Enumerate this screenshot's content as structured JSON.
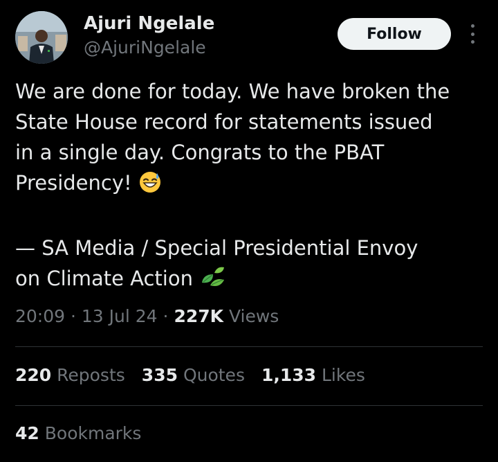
{
  "author": {
    "display_name": "Ajuri Ngelale",
    "handle": "@AjuriNgelale"
  },
  "follow_button_label": "Follow",
  "more_icon": "more-vertical-icon",
  "tweet": {
    "lines": [
      "We are done for today. We have broken the",
      "State House record for statements issued",
      "in a single day. Congrats to the PBAT",
      "Presidency!"
    ],
    "signature_lines": [
      "— SA Media / Special Presidential Envoy",
      "on Climate Action"
    ],
    "emojis": [
      "grinning-sweat-emoji",
      "leaves-emoji"
    ]
  },
  "meta": {
    "time": "20:09",
    "separator": "·",
    "date": "13 Jul 24",
    "views_count": "227K",
    "views_label": "Views"
  },
  "stats": {
    "reposts_count": "220",
    "reposts_label": "Reposts",
    "quotes_count": "335",
    "quotes_label": "Quotes",
    "likes_count": "1,133",
    "likes_label": "Likes",
    "bookmarks_count": "42",
    "bookmarks_label": "Bookmarks"
  },
  "colors": {
    "background": "#000000",
    "text_primary": "#e7e9ea",
    "text_secondary": "#71767b",
    "divider": "#2f3336",
    "button_bg": "#eff3f4",
    "button_text": "#0f1419"
  }
}
